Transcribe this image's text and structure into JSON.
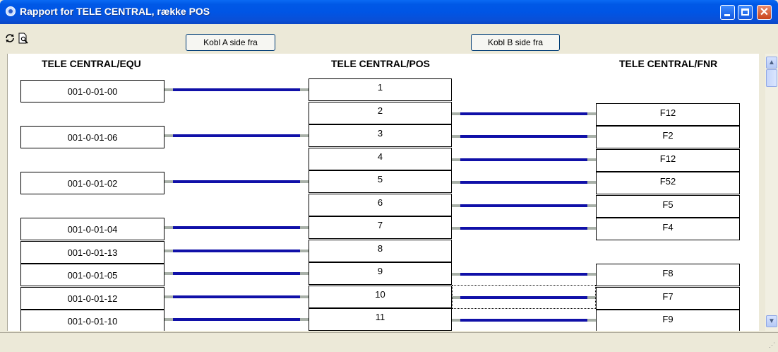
{
  "window": {
    "title": "Rapport for TELE CENTRAL, række POS"
  },
  "toolbar": {
    "refresh_icon": "refresh-icon",
    "preview_icon": "print-preview-icon",
    "btn_a_label": "Kobl A side fra",
    "btn_b_label": "Kobl B side fra"
  },
  "columns": {
    "equ": "TELE CENTRAL/EQU",
    "pos": "TELE CENTRAL/POS",
    "fnr": "TELE CENTRAL/FNR"
  },
  "rows": [
    {
      "equ": "001-0-01-00",
      "pos": "1",
      "fnr": ""
    },
    {
      "equ": "",
      "pos": "2",
      "fnr": "F12"
    },
    {
      "equ": "001-0-01-06",
      "pos": "3",
      "fnr": "F2"
    },
    {
      "equ": "",
      "pos": "4",
      "fnr": "F12"
    },
    {
      "equ": "001-0-01-02",
      "pos": "5",
      "fnr": "F52"
    },
    {
      "equ": "",
      "pos": "6",
      "fnr": "F5"
    },
    {
      "equ": "001-0-01-04",
      "pos": "7",
      "fnr": "F4"
    },
    {
      "equ": "001-0-01-13",
      "pos": "8",
      "fnr": ""
    },
    {
      "equ": "001-0-01-05",
      "pos": "9",
      "fnr": "F8"
    },
    {
      "equ": "001-0-01-12",
      "pos": "10",
      "fnr": "F7"
    },
    {
      "equ": "001-0-01-10",
      "pos": "11",
      "fnr": "F9"
    }
  ],
  "colors": {
    "wire": "#1010a8",
    "wire_end": "#a8b0a8"
  }
}
